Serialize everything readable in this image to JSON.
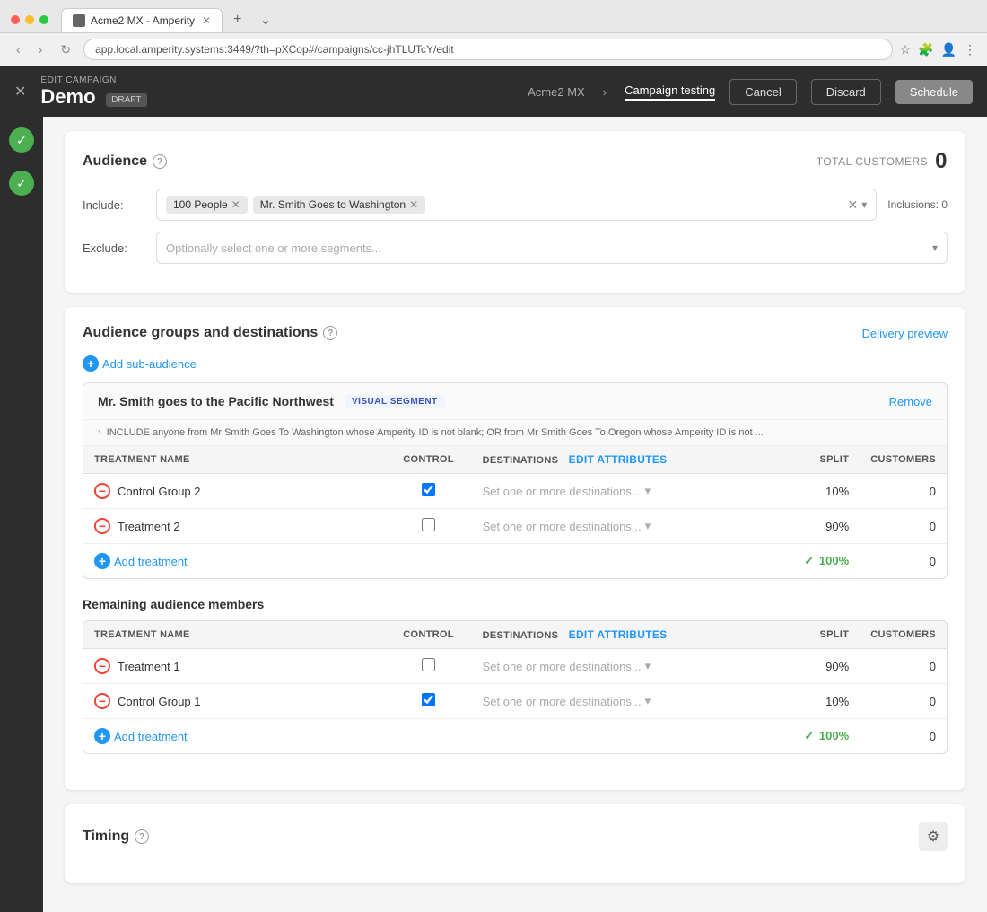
{
  "browser": {
    "tab_title": "Acme2 MX - Amperity",
    "url": "app.local.amperity.systems:3449/?th=pXCop#/campaigns/cc-jhTLUTcY/edit",
    "new_tab_label": "+"
  },
  "header": {
    "edit_label": "EDIT CAMPAIGN",
    "campaign_name": "Demo",
    "draft_label": "DRAFT",
    "breadcrumb": "Acme2 MX",
    "active_step": "Campaign testing",
    "cancel_label": "Cancel",
    "discard_label": "Discard",
    "schedule_label": "Schedule"
  },
  "audience": {
    "section_title": "Audience",
    "total_label": "TOTAL CUSTOMERS",
    "total_count": "0",
    "include_label": "Include:",
    "tags": [
      {
        "label": "100 People"
      },
      {
        "label": "Mr. Smith Goes to Washington"
      }
    ],
    "inclusions_label": "Inclusions:",
    "inclusions_count": "0",
    "exclude_label": "Exclude:",
    "exclude_placeholder": "Optionally select one or more segments..."
  },
  "audience_groups": {
    "section_title": "Audience groups and destinations",
    "delivery_preview_label": "Delivery preview",
    "add_sub_audience_label": "Add sub-audience",
    "group_name": "Mr. Smith goes to the Pacific Northwest",
    "group_badge": "VISUAL SEGMENT",
    "group_desc": "INCLUDE anyone from Mr Smith Goes To Washington whose Amperity ID is not blank; OR from Mr Smith Goes To Oregon whose Amperity ID is not ...",
    "remove_label": "Remove",
    "col_treatment": "TREATMENT NAME",
    "col_control": "CONTROL",
    "col_destinations": "DESTINATIONS",
    "col_edit_attributes": "Edit attributes",
    "col_split": "SPLIT",
    "col_customers": "CUSTOMERS",
    "treatments": [
      {
        "name": "Control Group 2",
        "control_checked": true,
        "destination_placeholder": "Set one or more destinations...",
        "split": "10%",
        "customers": "0"
      },
      {
        "name": "Treatment 2",
        "control_checked": false,
        "destination_placeholder": "Set one or more destinations...",
        "split": "90%",
        "customers": "0"
      }
    ],
    "add_treatment_label": "Add treatment",
    "total_split": "100%",
    "total_customers": "0"
  },
  "remaining": {
    "section_title": "Remaining audience members",
    "col_treatment": "TREATMENT NAME",
    "col_control": "CONTROL",
    "col_destinations": "DESTINATIONS",
    "col_edit_attributes": "Edit attributes",
    "col_split": "SPLIT",
    "col_customers": "CUSTOMERS",
    "treatments": [
      {
        "name": "Treatment 1",
        "control_checked": false,
        "destination_placeholder": "Set one or more destinations...",
        "split": "90%",
        "customers": "0"
      },
      {
        "name": "Control Group 1",
        "control_checked": true,
        "destination_placeholder": "Set one or more destinations...",
        "split": "10%",
        "customers": "0"
      }
    ],
    "add_treatment_label": "Add treatment",
    "total_split": "100%",
    "total_customers": "0"
  },
  "timing": {
    "section_title": "Timing"
  }
}
